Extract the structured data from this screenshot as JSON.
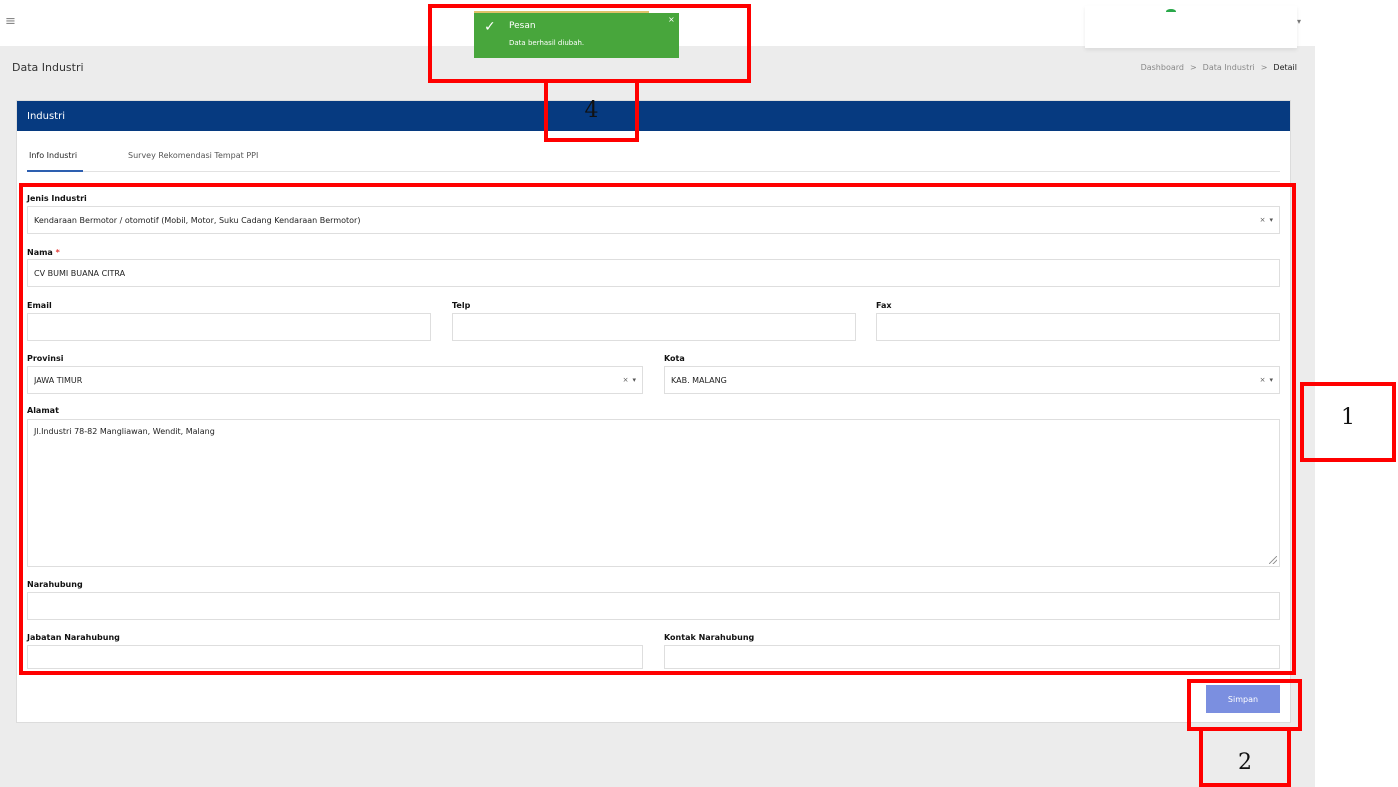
{
  "topbar": {
    "menu_icon": "≡",
    "user_caret": "▾"
  },
  "page": {
    "title": "Data Industri",
    "breadcrumb": [
      "Dashboard",
      ">",
      "Data Industri",
      ">",
      "Detail"
    ]
  },
  "card": {
    "header": "Industri",
    "tabs": [
      {
        "label": "Info Industri",
        "active": true
      },
      {
        "label": "Survey Rekomendasi Tempat PPI",
        "active": false
      }
    ]
  },
  "form": {
    "jenis_industri": {
      "label": "Jenis Industri",
      "value": "Kendaraan Bermotor / otomotif (Mobil, Motor, Suku Cadang Kendaraan Bermotor)",
      "clear": "×",
      "caret": "▾"
    },
    "nama": {
      "label": "Nama",
      "required_mark": "*",
      "value": "CV BUMI BUANA CITRA"
    },
    "email": {
      "label": "Email",
      "value": ""
    },
    "telp": {
      "label": "Telp",
      "value": ""
    },
    "fax": {
      "label": "Fax",
      "value": ""
    },
    "provinsi": {
      "label": "Provinsi",
      "value": "JAWA TIMUR",
      "clear": "×",
      "caret": "▾"
    },
    "kota": {
      "label": "Kota",
      "value": "KAB. MALANG",
      "clear": "×",
      "caret": "▾"
    },
    "alamat": {
      "label": "Alamat",
      "value": "Jl.Industri 78-82 Mangliawan, Wendit, Malang"
    },
    "narahubung": {
      "label": "Narahubung",
      "value": ""
    },
    "jabatan_narahubung": {
      "label": "Jabatan Narahubung",
      "value": ""
    },
    "kontak_narahubung": {
      "label": "Kontak Narahubung",
      "value": ""
    },
    "submit_label": "Simpan"
  },
  "toast": {
    "check": "✓",
    "title": "Pesan",
    "message": "Data berhasil diubah.",
    "close": "×"
  },
  "annotations": [
    "1",
    "2",
    "4"
  ],
  "colors": {
    "header_bg": "#063a80",
    "toast_bg": "#48a63c",
    "button_bg": "#7b8fe0",
    "annotation": "#ff0000"
  }
}
